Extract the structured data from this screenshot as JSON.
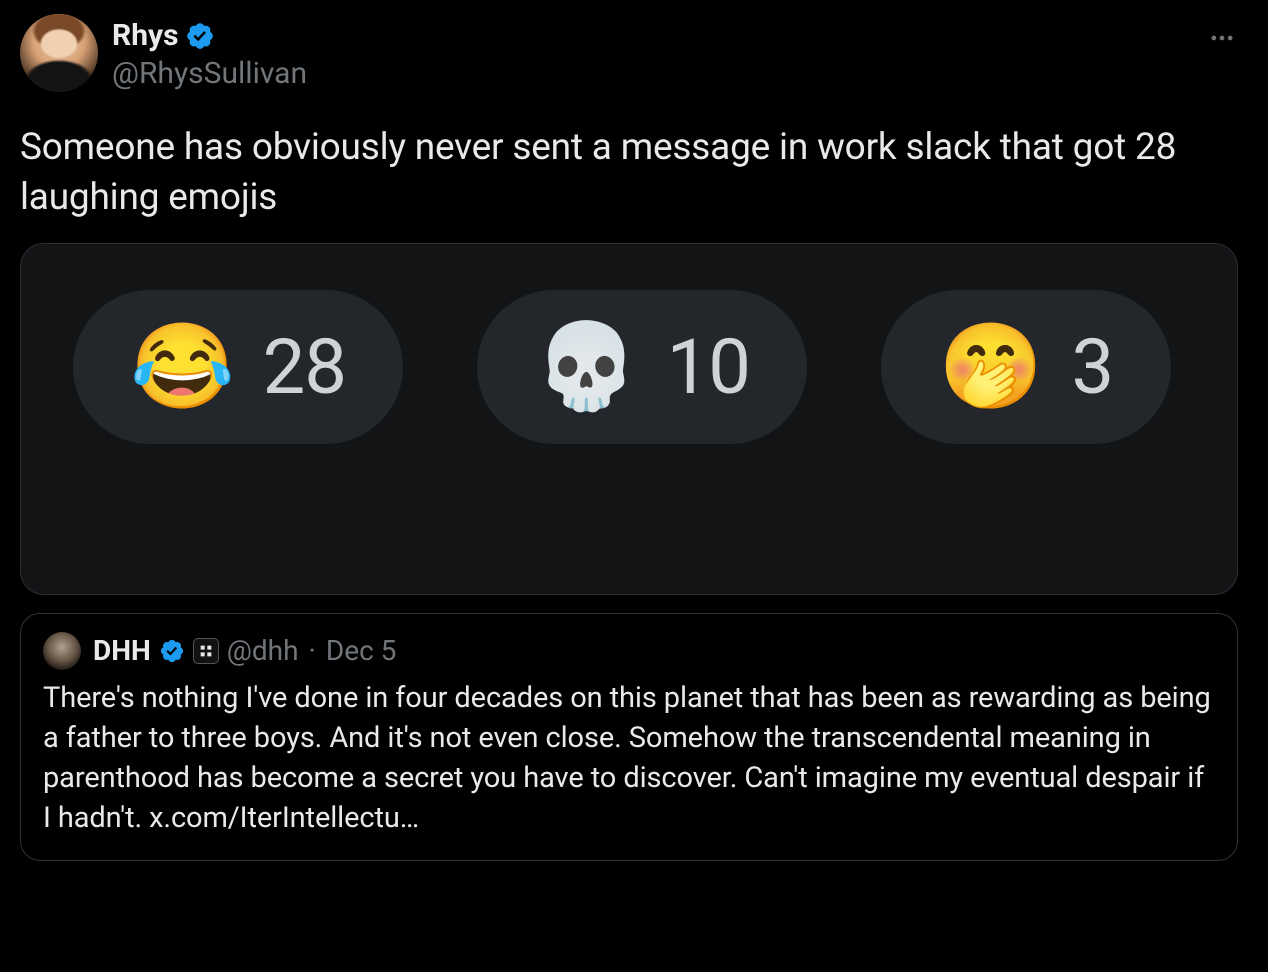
{
  "tweet": {
    "author": {
      "display_name": "Rhys",
      "handle": "@RhysSullivan"
    },
    "text": "Someone has obviously never sent a message in work slack that got 28 laughing emojis",
    "reactions": [
      {
        "emoji": "😂",
        "count": "28",
        "name": "face-with-tears-of-joy"
      },
      {
        "emoji": "💀",
        "count": "10",
        "name": "skull"
      },
      {
        "emoji": "🤭",
        "count": "3",
        "name": "face-with-hand-over-mouth"
      }
    ]
  },
  "quote": {
    "author": {
      "display_name": "DHH",
      "handle": "@dhh",
      "date": "Dec 5"
    },
    "separator": "·",
    "text": "There's nothing I've done in four decades on this planet that has been as rewarding as being a father to three boys. And it's not even close. Somehow the transcendental meaning in parenthood has become a secret you have to discover. Can't imagine my eventual despair if I hadn't. ",
    "link_text": "x.com/IterIntellectu…"
  }
}
